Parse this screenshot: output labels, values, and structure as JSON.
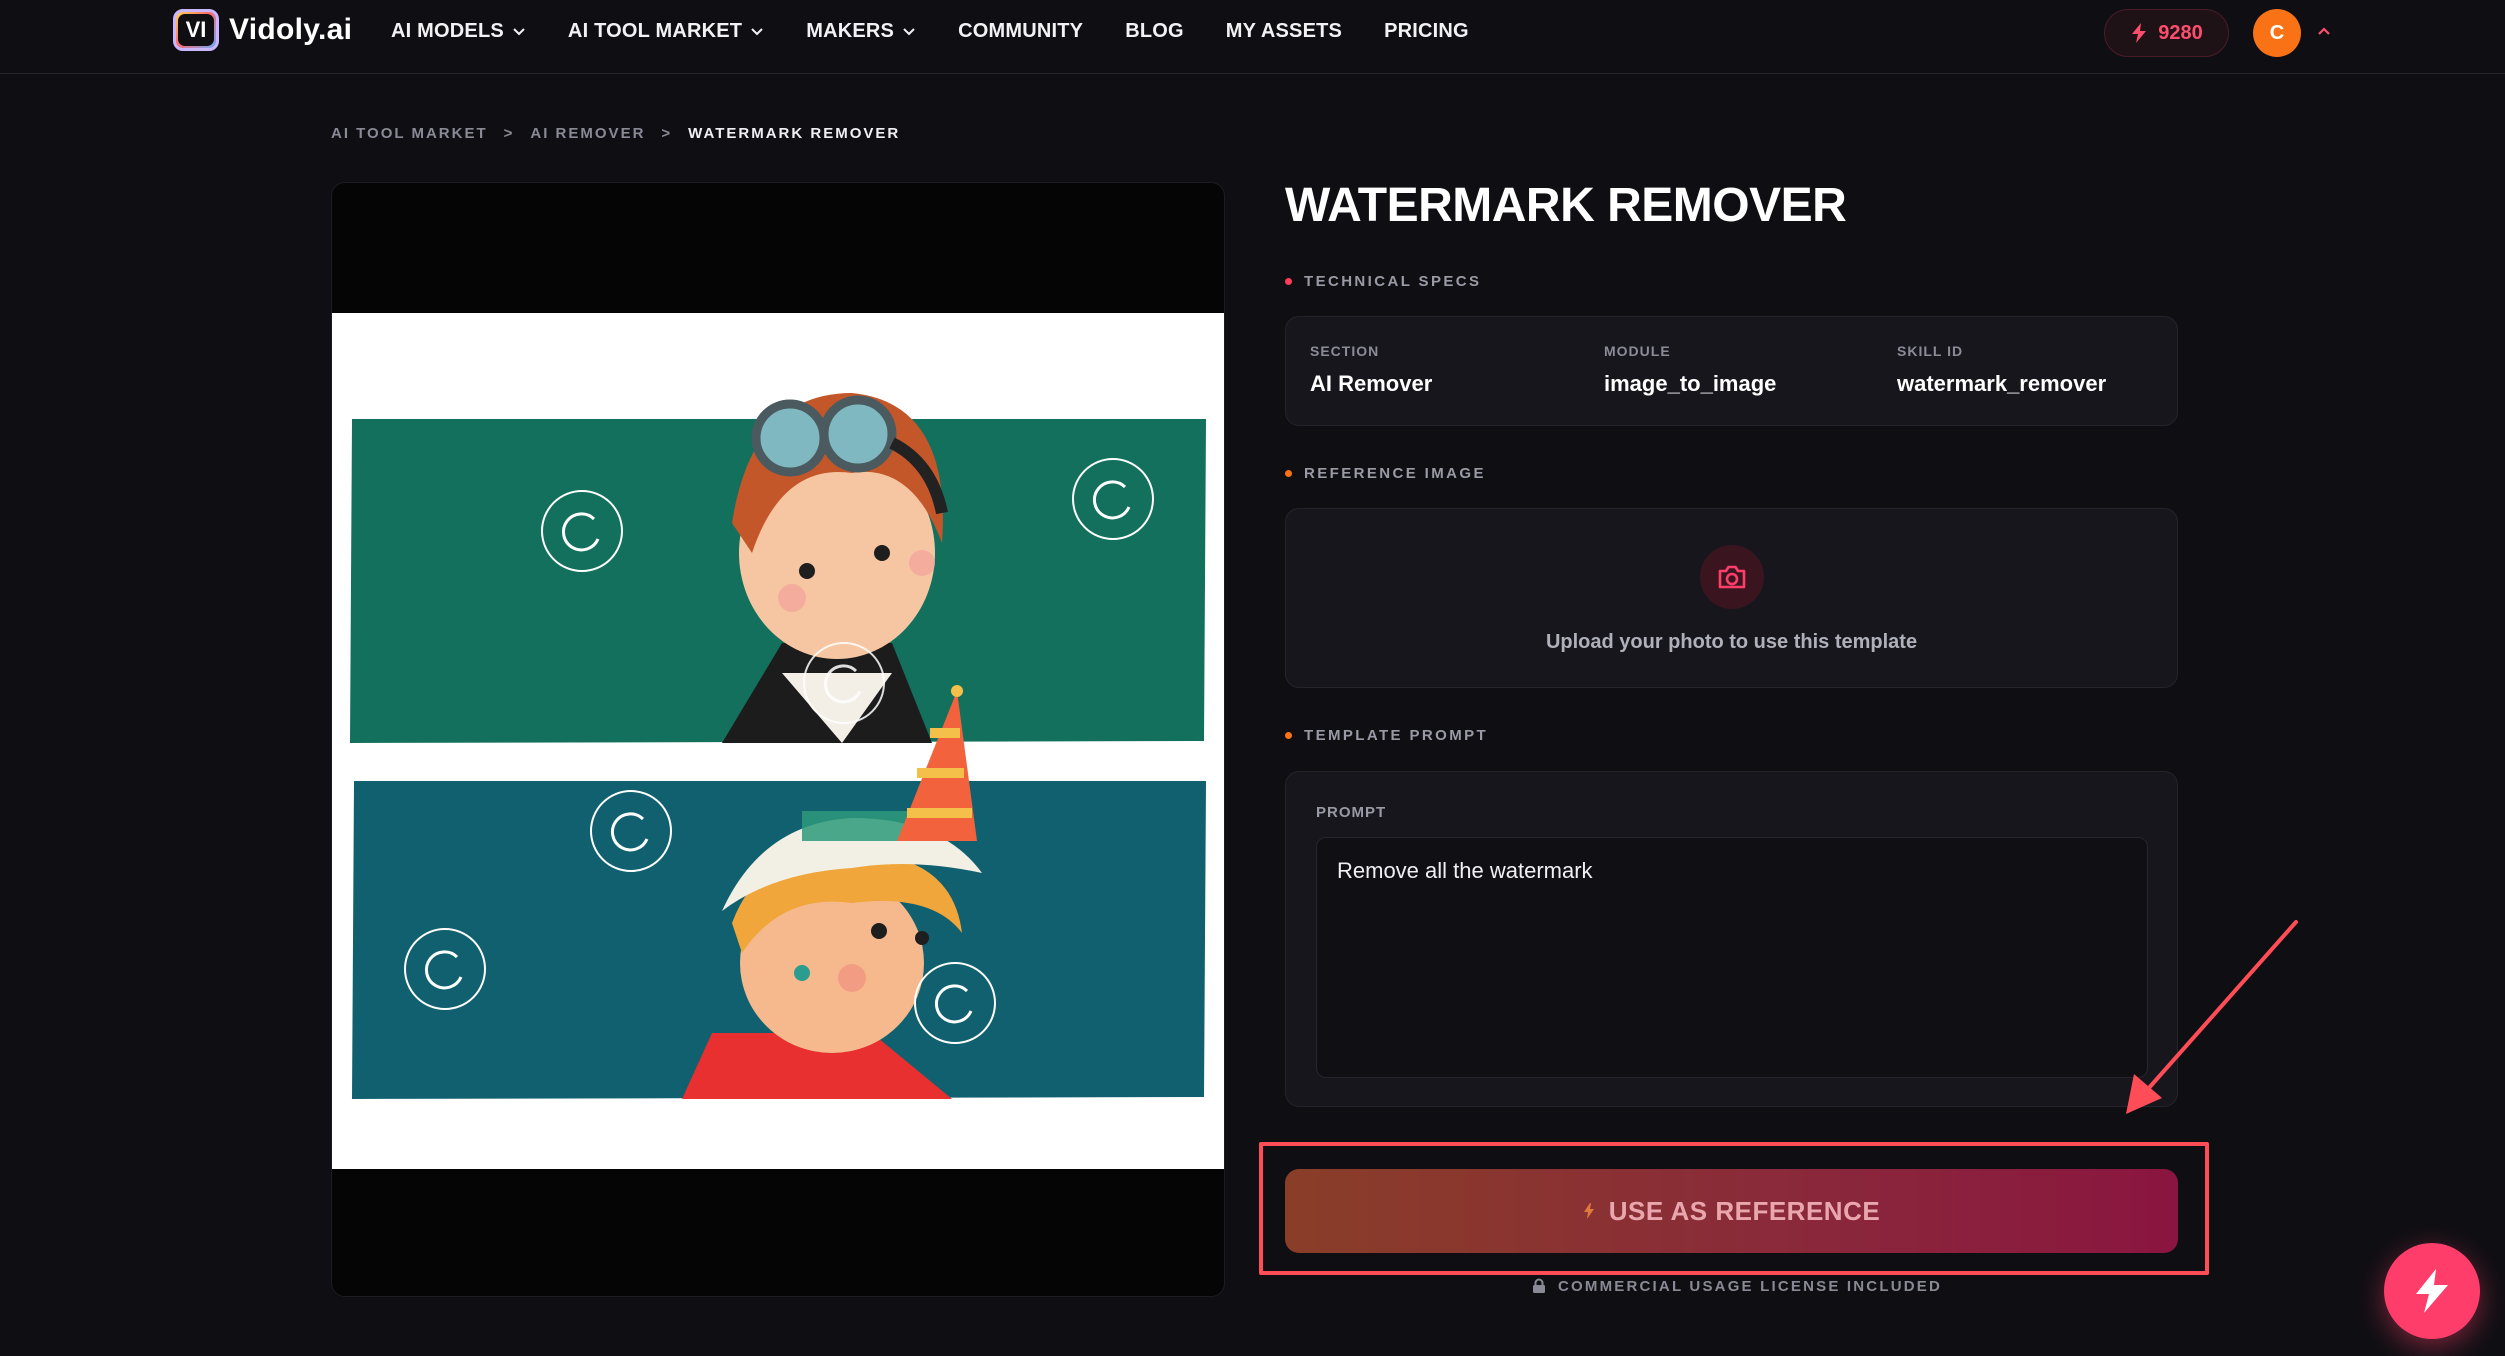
{
  "brand": {
    "name": "Vidoly.ai",
    "mark": "VI"
  },
  "nav": {
    "items": [
      {
        "label": "AI MODELS",
        "has_dropdown": true
      },
      {
        "label": "AI TOOL MARKET",
        "has_dropdown": true
      },
      {
        "label": "MAKERS",
        "has_dropdown": true
      },
      {
        "label": "COMMUNITY",
        "has_dropdown": false
      },
      {
        "label": "BLOG",
        "has_dropdown": false
      },
      {
        "label": "MY ASSETS",
        "has_dropdown": false
      },
      {
        "label": "PRICING",
        "has_dropdown": false
      }
    ],
    "credits": "9280",
    "avatar_initial": "C"
  },
  "breadcrumb": {
    "items": [
      "AI TOOL MARKET",
      "AI REMOVER",
      "WATERMARK REMOVER"
    ],
    "separator": ">"
  },
  "page": {
    "title": "WATERMARK REMOVER",
    "technical_specs": {
      "label": "TECHNICAL SPECS",
      "section_label": "SECTION",
      "section_value": "AI Remover",
      "module_label": "MODULE",
      "module_value": "image_to_image",
      "skill_label": "SKILL ID",
      "skill_value": "watermark_remover"
    },
    "reference_image": {
      "label": "REFERENCE IMAGE",
      "upload_text": "Upload your photo to use this template"
    },
    "template_prompt": {
      "label": "TEMPLATE PROMPT",
      "prompt_label": "PROMPT",
      "prompt_value": "Remove all the watermark"
    },
    "action_button": "USE AS REFERENCE",
    "license": "COMMERCIAL USAGE LICENSE INCLUDED"
  },
  "colors": {
    "accent": "#ff3d6b",
    "dot_specs": "#ff3d5a",
    "dot_reference": "#f97316",
    "dot_prompt": "#f97316",
    "annotation": "#ff4d57"
  },
  "icons": {
    "credits": "bolt-icon",
    "upload": "camera-icon",
    "license": "lock-icon",
    "fab": "bolt-icon",
    "watermark": "refresh-circle-icon"
  }
}
